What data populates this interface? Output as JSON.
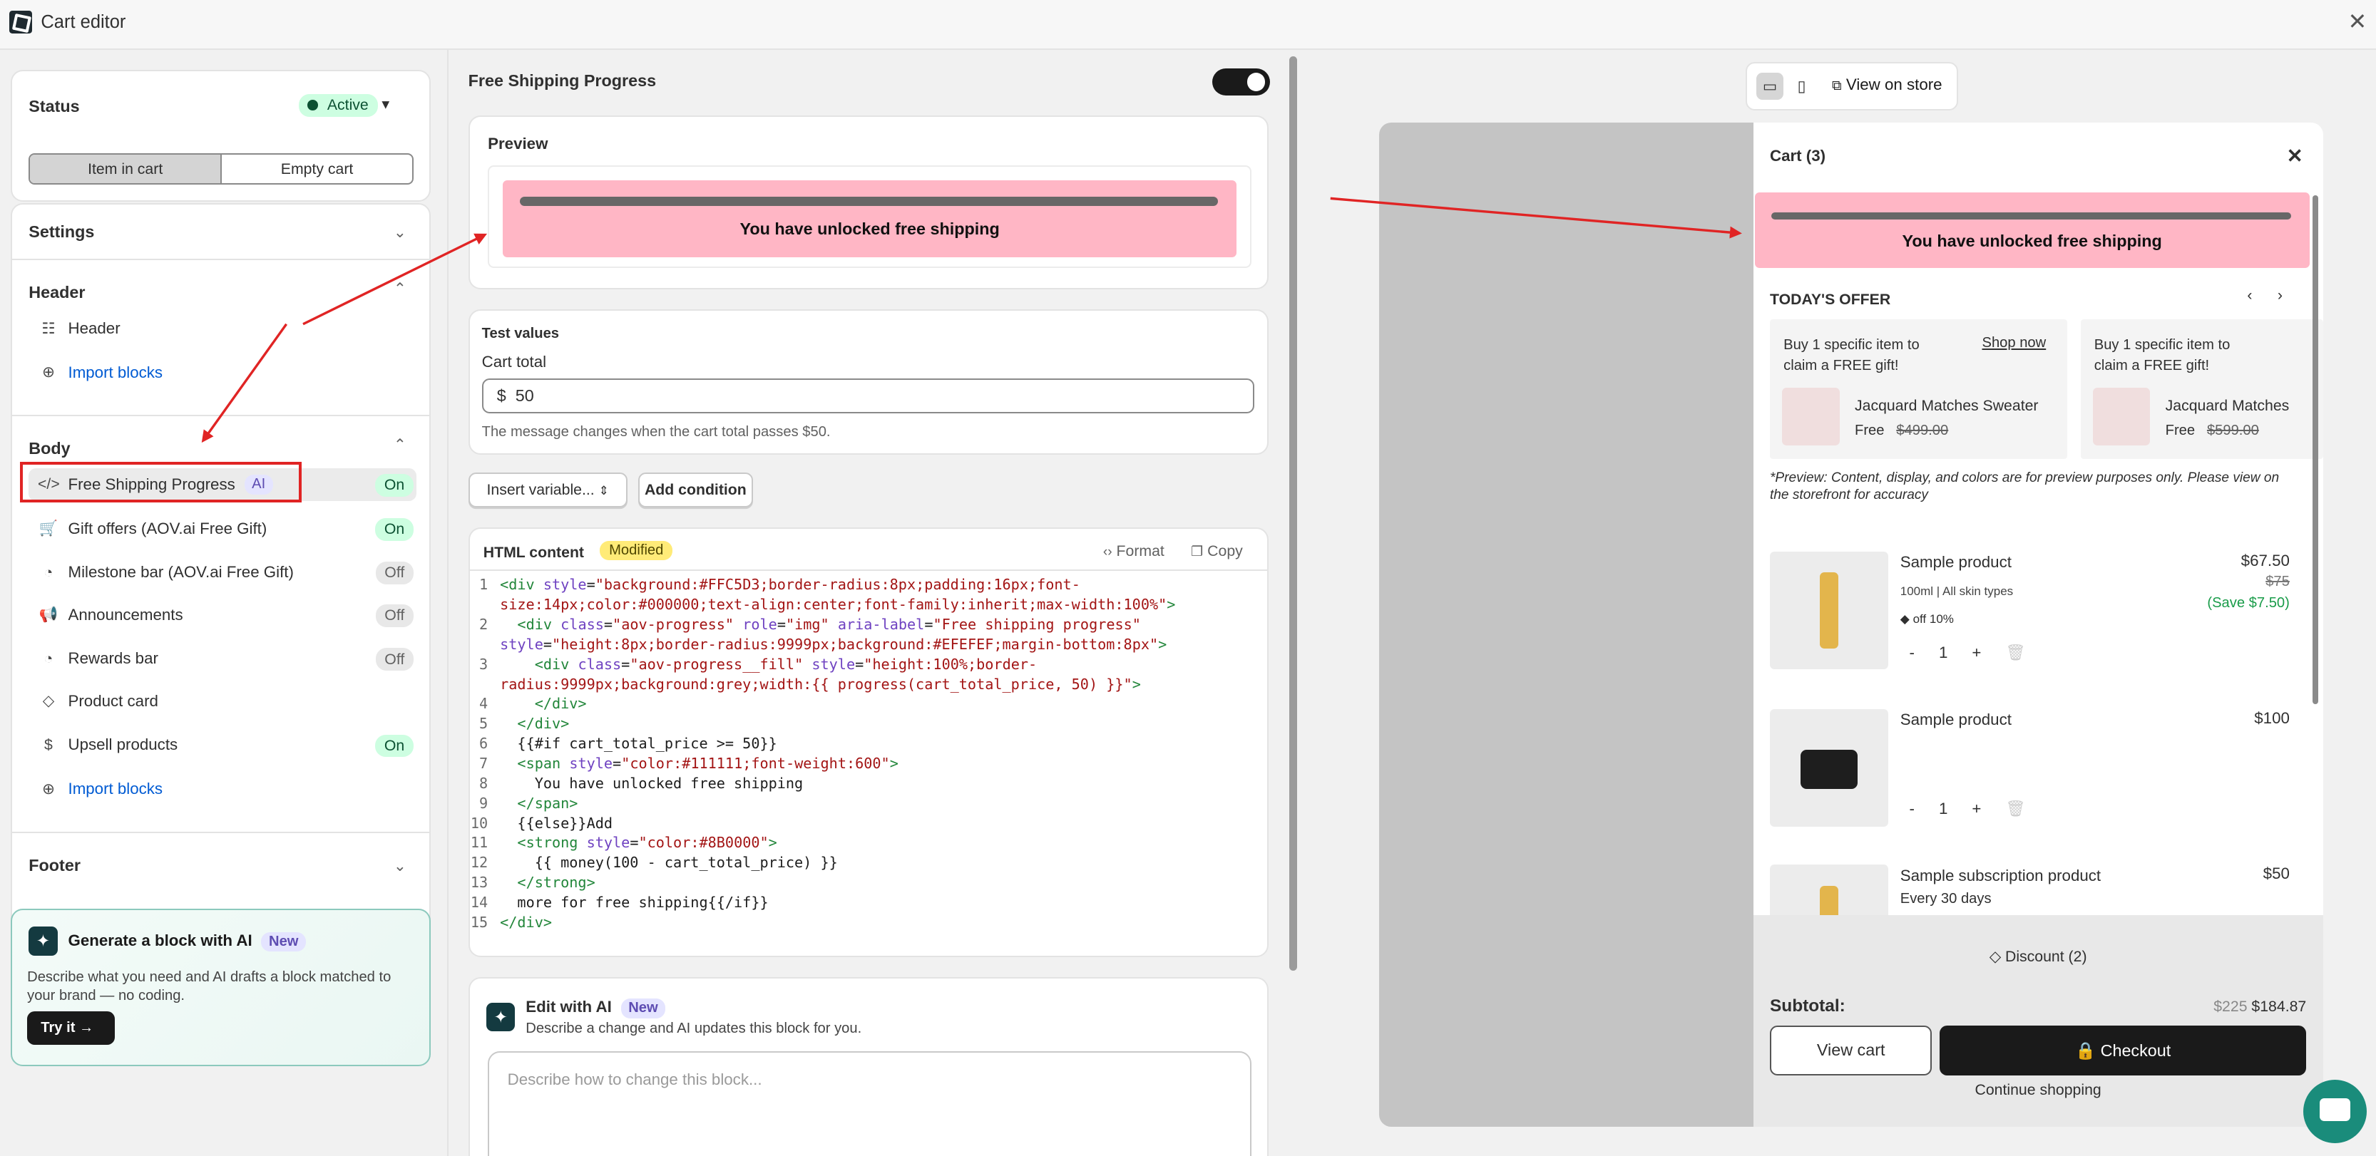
{
  "app": {
    "title": "Cart editor"
  },
  "status": {
    "label": "Status",
    "badge": "Active",
    "seg_item": "Item in cart",
    "seg_empty": "Empty cart"
  },
  "settings": {
    "label": "Settings"
  },
  "header_section": {
    "label": "Header",
    "item": "Header",
    "import": "Import blocks"
  },
  "body_section": {
    "label": "Body",
    "items": [
      {
        "label": "Free Shipping Progress",
        "tag": "AI",
        "state": "On"
      },
      {
        "label": "Gift offers (AOV.ai Free Gift)",
        "state": "On"
      },
      {
        "label": "Milestone bar (AOV.ai Free Gift)",
        "state": "Off"
      },
      {
        "label": "Announcements",
        "state": "Off"
      },
      {
        "label": "Rewards bar",
        "state": "Off"
      },
      {
        "label": "Product card",
        "state": ""
      },
      {
        "label": "Upsell products",
        "state": "On"
      }
    ],
    "import": "Import blocks"
  },
  "footer_section": {
    "label": "Footer"
  },
  "ai_promo": {
    "title": "Generate a block with AI",
    "badge": "New",
    "desc": "Describe what you need and AI drafts a block matched to your brand — no coding.",
    "button": "Try it"
  },
  "editor": {
    "title": "Free Shipping Progress",
    "preview_label": "Preview",
    "preview_text": "You have unlocked free shipping",
    "test_values_label": "Test values",
    "cart_total_label": "Cart total",
    "currency": "$",
    "cart_total_value": "50",
    "help": "The message changes when the cart total passes $50.",
    "insert_variable": "Insert variable...",
    "add_condition": "Add condition",
    "html_label": "HTML content",
    "modified": "Modified",
    "format": "Format",
    "copy": "Copy",
    "edit_ai_title": "Edit with AI",
    "edit_ai_badge": "New",
    "edit_ai_desc": "Describe a change and AI updates this block for you.",
    "edit_ai_placeholder": "Describe how to change this block..."
  },
  "store_preview": {
    "view_on_store": "View on store",
    "cart_title": "Cart (3)",
    "banner_text": "You have unlocked free shipping",
    "todays_offer": "TODAY'S OFFER",
    "offers": [
      {
        "text": "Buy 1 specific item to claim a FREE gift!",
        "link": "Shop now",
        "product": "Jacquard Matches Sweater",
        "free": "Free",
        "price": "$499.00"
      },
      {
        "text": "Buy 1 specific item to claim a FREE gift!",
        "product": "Jacquard Matches",
        "free": "Free",
        "price": "$599.00"
      }
    ],
    "note": "*Preview: Content, display, and colors are for preview purposes only. Please view on the storefront for accuracy",
    "products": [
      {
        "name": "Sample product",
        "variant": "100ml | All skin types",
        "discount": "off 10%",
        "price": "$67.50",
        "compare": "$75",
        "save": "(Save $7.50)",
        "qty": "1"
      },
      {
        "name": "Sample product",
        "price": "$100",
        "qty": "1"
      },
      {
        "name": "Sample subscription product",
        "variant": "Every 30 days",
        "price": "$50"
      }
    ],
    "discount": "Discount (2)",
    "subtotal_label": "Subtotal:",
    "subtotal_compare": "$225",
    "subtotal": "$184.87",
    "view_cart": "View cart",
    "checkout": "Checkout",
    "continue": "Continue shopping"
  },
  "colors": {
    "accent_red": "#e02424",
    "pink_banner": "#ffb6c5",
    "active_green": "#cdfee1"
  }
}
